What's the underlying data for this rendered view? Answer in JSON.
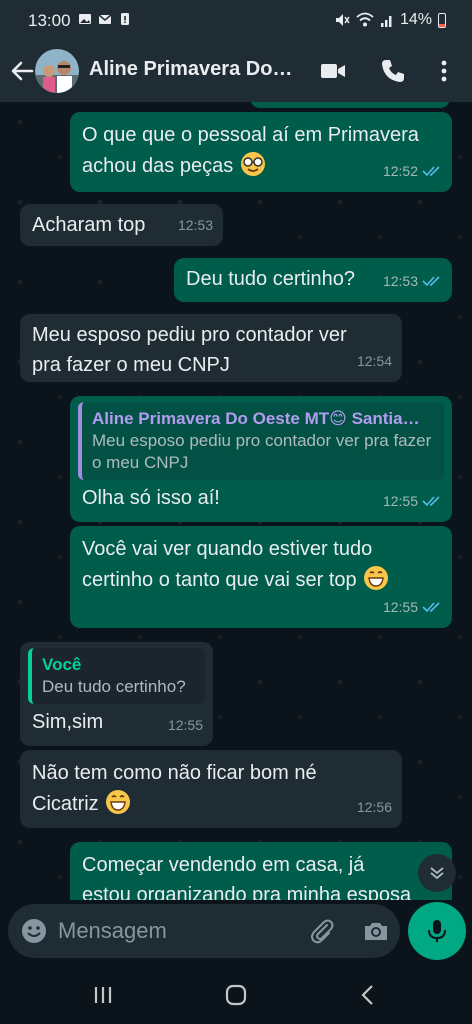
{
  "status": {
    "time": "13:00",
    "battery": "14%"
  },
  "header": {
    "title": "Aline Primavera Do…"
  },
  "messages": [
    {
      "text1": "O que que o pessoal aí em Primavera",
      "text2": "achou das peças",
      "time": "12:52"
    },
    {
      "text": "Acharam top",
      "time": "12:53"
    },
    {
      "text": "Deu tudo certinho?",
      "time": "12:53"
    },
    {
      "text1": "Meu esposo pediu pro contador ver",
      "text2": "pra fazer o meu  CNPJ",
      "time": "12:54"
    },
    {
      "quote_name": "Aline Primavera Do Oeste MT😊 Santia…",
      "quote_text": "Meu esposo pediu pro contador ver pra fazer o meu  CNPJ",
      "text": "Olha só isso aí!",
      "time": "12:55"
    },
    {
      "text1": "Você vai ver quando estiver tudo",
      "text2": "certinho o tanto que vai ser top",
      "time": "12:55"
    },
    {
      "quote_name": "Você",
      "quote_text": "Deu tudo certinho?",
      "text": "Sim,sim",
      "time": "12:55"
    },
    {
      "text1": "Não tem como não ficar bom né",
      "text2": "Cicatriz",
      "time": "12:56"
    },
    {
      "text1": "Começar vendendo em casa, já",
      "text2": "estou organizando pra minha esposa"
    }
  ],
  "composer": {
    "placeholder": "Mensagem"
  },
  "colors": {
    "outgoing": "#005c4b",
    "incoming": "#202c33",
    "accent": "#00a884",
    "ticks": "#53bdeb"
  },
  "icons": [
    "back-arrow-icon",
    "video-call-icon",
    "phone-icon",
    "more-options-icon",
    "emoji-icon",
    "attach-icon",
    "camera-icon",
    "mic-icon",
    "chevron-down-icon"
  ]
}
